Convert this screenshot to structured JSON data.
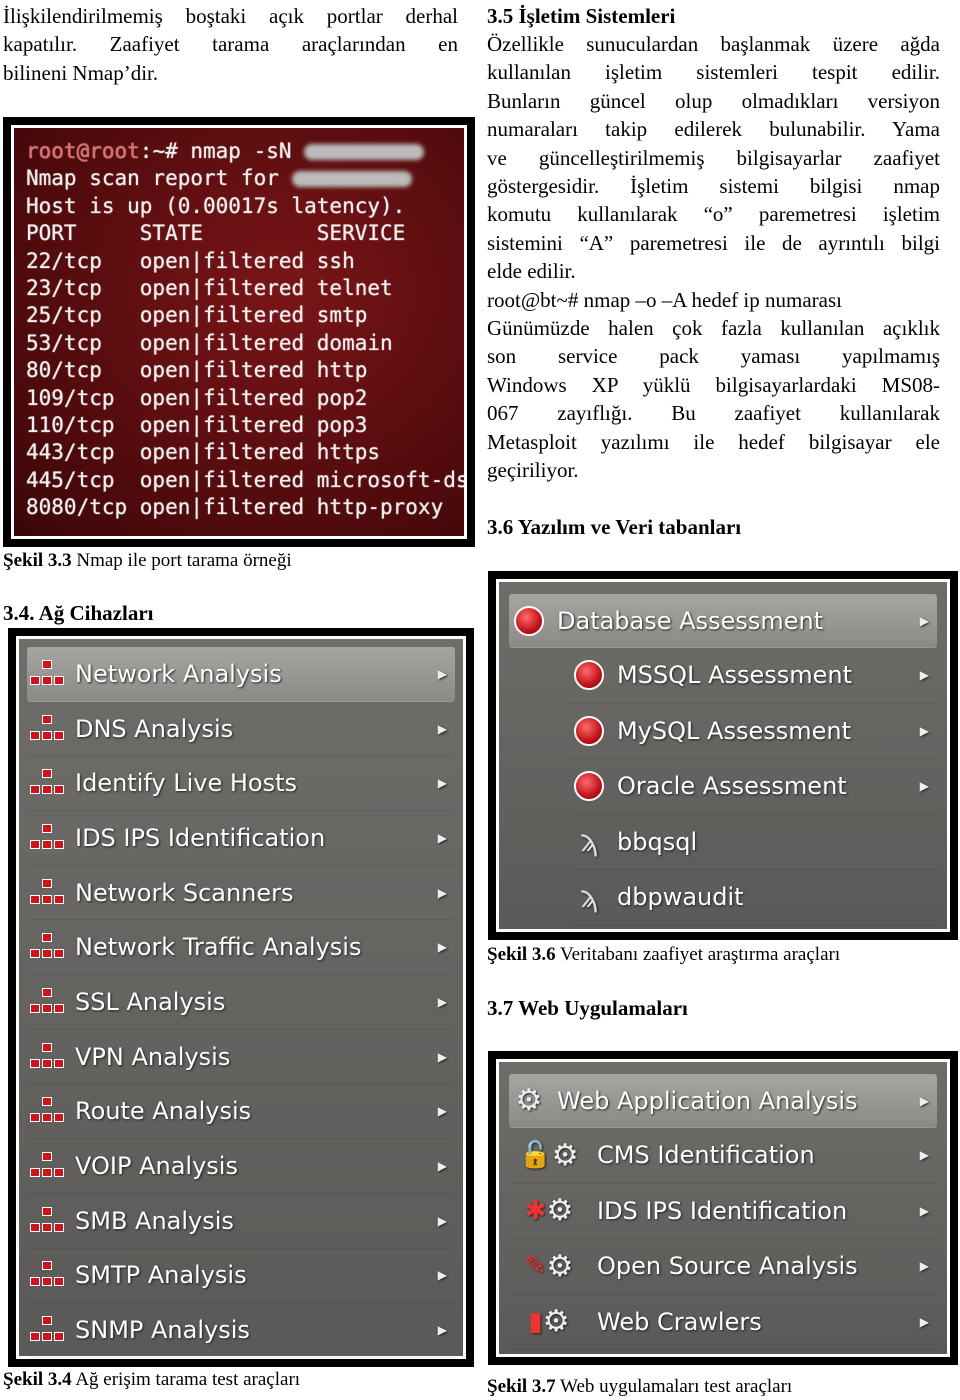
{
  "left_intro": [
    "İlişkilendirilmemiş boştaki açık portlar derhal",
    "kapatılır.  Zaafiyet tarama araçlarından en",
    "bilineni Nmap’dir."
  ],
  "terminal": {
    "prompt": "root@root",
    "command": ":~# nmap -sN ",
    "lines": [
      "Nmap scan report for ",
      "Host is up (0.00017s latency).",
      "PORT     STATE         SERVICE",
      "22/tcp   open|filtered ssh",
      "23/tcp   open|filtered telnet",
      "25/tcp   open|filtered smtp",
      "53/tcp   open|filtered domain",
      "80/tcp   open|filtered http",
      "109/tcp  open|filtered pop2",
      "110/tcp  open|filtered pop3",
      "443/tcp  open|filtered https",
      "445/tcp  open|filtered microsoft-ds",
      "8080/tcp open|filtered http-proxy"
    ]
  },
  "fig33": {
    "label": "Şekil 3.3",
    "text": " Nmap ile port tarama örneği"
  },
  "sec34": "3.4. Ağ Cihazları",
  "network_menu": [
    "Network Analysis",
    "DNS Analysis",
    "Identify Live Hosts",
    "IDS IPS Identification",
    "Network Scanners",
    "Network Traffic Analysis",
    "SSL Analysis",
    "VPN Analysis",
    "Route Analysis",
    "VOIP Analysis",
    "SMB Analysis",
    "SMTP Analysis",
    "SNMP Analysis"
  ],
  "fig34": {
    "label": "Şekil 3.4",
    "text": " Ağ erişim tarama test araçları"
  },
  "sec35": "3.5 İşletim Sistemleri",
  "sec35_lines": [
    "Özellikle sunuculardan başlanmak üzere ağda",
    "kullanılan  işletim  sistemleri  tespit  edilir.",
    "Bunların  güncel  olup  olmadıkları  versiyon",
    "numaraları  takip  edilerek  bulunabilir.  Yama",
    "ve  güncelleştirilmemiş  bilgisayarlar  zaafiyet",
    "göstergesidir.  İşletim  sistemi  bilgisi  nmap",
    "komutu  kullanılarak  “o”  paremetresi  işletim",
    "sistemini  “A”  paremetresi ile de ayrıntılı bilgi",
    "elde edilir.",
    "root@bt~# nmap –o –A hedef ip numarası",
    "Günümüzde halen çok fazla kullanılan açıklık",
    "son    service    pack    yaması    yapılmamış",
    "Windows XP yüklü bilgisayarlardaki MS08-",
    "067     zayıflığı.  Bu  zaafiyet  kullanılarak",
    "Metasploit  yazılımı  ile  hedef  bilgisayar  ele",
    "geçiriliyor."
  ],
  "sec36": "3.6 Yazılım ve Veri tabanları",
  "db_menu": {
    "header": "Database Assessment",
    "items": [
      "MSSQL Assessment",
      "MySQL Assessment",
      "Oracle Assessment",
      "bbqsql",
      "dbpwaudit"
    ]
  },
  "fig36": {
    "label": "Şekil 3.6",
    "text": " Veritabanı zaafiyet araştırma araçları"
  },
  "sec37": "3.7 Web Uygulamaları",
  "web_menu": {
    "header": "Web Application Analysis",
    "items": [
      "CMS Identification",
      "IDS IPS Identification",
      "Open Source Analysis",
      "Web Crawlers"
    ]
  },
  "fig37": {
    "label": "Şekil 3.7",
    "text": " Web uygulamaları test araçları"
  }
}
